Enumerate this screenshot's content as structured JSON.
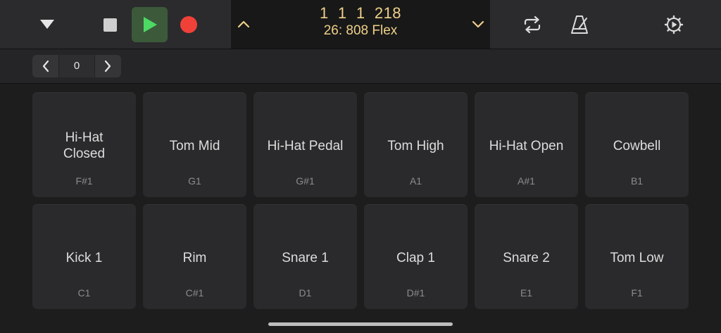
{
  "transport": {
    "menu_icon": "dropdown-triangle-icon",
    "stop_icon": "stop-icon",
    "play_icon": "play-icon",
    "record_icon": "record-icon",
    "colors": {
      "play_bg": "#3c5a3a",
      "play": "#4cd964",
      "record": "#f04138"
    }
  },
  "lcd": {
    "position": "1  1  1  218",
    "patch": "26: 808 Flex",
    "prev_icon": "chevron-up-icon",
    "next_icon": "chevron-down-icon",
    "color": "#efd08a"
  },
  "toolbar": {
    "cycle_icon": "cycle-icon",
    "metronome_icon": "metronome-icon",
    "settings_icon": "settings-gear-icon"
  },
  "bank": {
    "value": "0"
  },
  "pads": [
    {
      "name": "Hi-Hat\nClosed",
      "note": "F#1"
    },
    {
      "name": "Tom Mid",
      "note": "G1"
    },
    {
      "name": "Hi-Hat Pedal",
      "note": "G#1"
    },
    {
      "name": "Tom High",
      "note": "A1"
    },
    {
      "name": "Hi-Hat Open",
      "note": "A#1"
    },
    {
      "name": "Cowbell",
      "note": "B1"
    },
    {
      "name": "Kick 1",
      "note": "C1"
    },
    {
      "name": "Rim",
      "note": "C#1"
    },
    {
      "name": "Snare 1",
      "note": "D1"
    },
    {
      "name": "Clap 1",
      "note": "D#1"
    },
    {
      "name": "Snare 2",
      "note": "E1"
    },
    {
      "name": "Tom Low",
      "note": "F1"
    }
  ]
}
